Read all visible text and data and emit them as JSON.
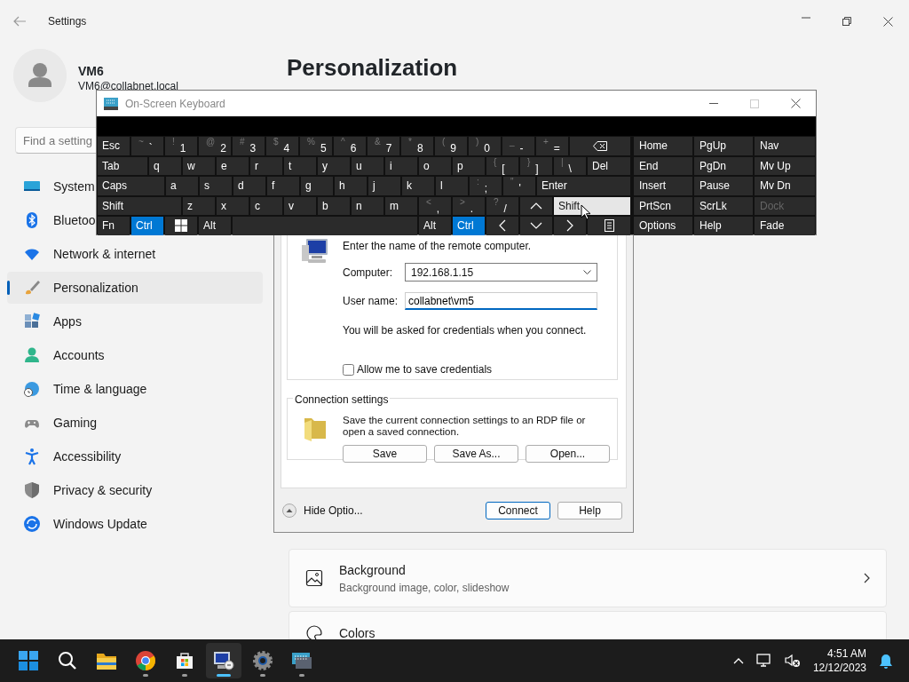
{
  "settings": {
    "title": "Settings",
    "account": {
      "name": "VM6",
      "email": "VM6@collabnet.local"
    },
    "search": {
      "placeholder": "Find a setting"
    },
    "nav": [
      {
        "kind": "system",
        "label": "System",
        "selected": false
      },
      {
        "kind": "bluetooth",
        "label": "Bluetoo",
        "selected": false
      },
      {
        "kind": "network",
        "label": "Network & internet",
        "selected": false
      },
      {
        "kind": "personalization",
        "label": "Personalization",
        "selected": true
      },
      {
        "kind": "apps",
        "label": "Apps",
        "selected": false
      },
      {
        "kind": "accounts",
        "label": "Accounts",
        "selected": false
      },
      {
        "kind": "time",
        "label": "Time & language",
        "selected": false
      },
      {
        "kind": "gaming",
        "label": "Gaming",
        "selected": false
      },
      {
        "kind": "accessibility",
        "label": "Accessibility",
        "selected": false
      },
      {
        "kind": "privacy",
        "label": "Privacy & security",
        "selected": false
      },
      {
        "kind": "update",
        "label": "Windows Update",
        "selected": false
      }
    ],
    "page_title": "Personalization",
    "cards": [
      {
        "kind": "background",
        "title": "Background",
        "subtitle": "Background image, color, slideshow"
      },
      {
        "kind": "colors",
        "title": "Colors"
      }
    ]
  },
  "remote_desktop": {
    "prompt": "Enter the name of the remote computer.",
    "computer": {
      "label": "Computer:",
      "value": "192.168.1.15"
    },
    "user": {
      "label": "User name:",
      "value": "collabnet\\vm5",
      "focused": true
    },
    "note": "You will be asked for credentials when you connect.",
    "save_credentials": {
      "label": "Allow me to save credentials",
      "checked": false
    },
    "connection_settings": {
      "legend": "Connection settings",
      "text": "Save the current connection settings to an RDP file or open a saved connection.",
      "buttons": [
        "Save",
        "Save As...",
        "Open..."
      ]
    },
    "options_toggle": "Hide Optio...",
    "buttons": [
      {
        "label": "Connect",
        "default": true
      },
      {
        "label": "Help",
        "default": false
      }
    ]
  },
  "keyboard": {
    "title": "On-Screen Keyboard",
    "rows": [
      [
        {
          "kind": "text",
          "label": "Esc",
          "pressed": false,
          "hovered": false
        },
        {
          "kind": "text",
          "label": "`",
          "shift": "~",
          "pressed": false,
          "hovered": false
        },
        {
          "kind": "text",
          "label": "1",
          "shift": "!",
          "pressed": false,
          "hovered": false
        },
        {
          "kind": "text",
          "label": "2",
          "shift": "@",
          "pressed": false,
          "hovered": false
        },
        {
          "kind": "text",
          "label": "3",
          "shift": "#",
          "pressed": false,
          "hovered": false
        },
        {
          "kind": "text",
          "label": "4",
          "shift": "$",
          "pressed": false,
          "hovered": false
        },
        {
          "kind": "text",
          "label": "5",
          "shift": "%",
          "pressed": false,
          "hovered": false
        },
        {
          "kind": "text",
          "label": "6",
          "shift": "^",
          "pressed": false,
          "hovered": false
        },
        {
          "kind": "text",
          "label": "7",
          "shift": "&",
          "pressed": false,
          "hovered": false
        },
        {
          "kind": "text",
          "label": "8",
          "shift": "*",
          "pressed": false,
          "hovered": false
        },
        {
          "kind": "text",
          "label": "9",
          "shift": "(",
          "pressed": false,
          "hovered": false
        },
        {
          "kind": "text",
          "label": "0",
          "shift": ")",
          "pressed": false,
          "hovered": false
        },
        {
          "kind": "text",
          "label": "-",
          "shift": "_",
          "pressed": false,
          "hovered": false
        },
        {
          "kind": "text",
          "label": "=",
          "shift": "+",
          "pressed": false,
          "hovered": false
        },
        {
          "kind": "backspace",
          "pressed": false,
          "hovered": false
        }
      ],
      [
        {
          "kind": "text",
          "label": "Tab",
          "pressed": false,
          "hovered": false
        },
        {
          "kind": "text",
          "label": "q",
          "pressed": false,
          "hovered": false
        },
        {
          "kind": "text",
          "label": "w",
          "pressed": false,
          "hovered": false
        },
        {
          "kind": "text",
          "label": "e",
          "pressed": false,
          "hovered": false
        },
        {
          "kind": "text",
          "label": "r",
          "pressed": false,
          "hovered": false
        },
        {
          "kind": "text",
          "label": "t",
          "pressed": false,
          "hovered": false
        },
        {
          "kind": "text",
          "label": "y",
          "pressed": false,
          "hovered": false
        },
        {
          "kind": "text",
          "label": "u",
          "pressed": false,
          "hovered": false
        },
        {
          "kind": "text",
          "label": "i",
          "pressed": false,
          "hovered": false
        },
        {
          "kind": "text",
          "label": "o",
          "pressed": false,
          "hovered": false
        },
        {
          "kind": "text",
          "label": "p",
          "pressed": false,
          "hovered": false
        },
        {
          "kind": "text",
          "label": "[",
          "shift": "{",
          "pressed": false,
          "hovered": false
        },
        {
          "kind": "text",
          "label": "]",
          "shift": "}",
          "pressed": false,
          "hovered": false
        },
        {
          "kind": "text",
          "label": "\\",
          "shift": "|",
          "pressed": false,
          "hovered": false
        },
        {
          "kind": "text",
          "label": "Del",
          "pressed": false,
          "hovered": false
        }
      ],
      [
        {
          "kind": "text",
          "label": "Caps",
          "pressed": false,
          "hovered": false
        },
        {
          "kind": "text",
          "label": "a",
          "pressed": false,
          "hovered": false
        },
        {
          "kind": "text",
          "label": "s",
          "pressed": false,
          "hovered": false
        },
        {
          "kind": "text",
          "label": "d",
          "pressed": false,
          "hovered": false
        },
        {
          "kind": "text",
          "label": "f",
          "pressed": false,
          "hovered": false
        },
        {
          "kind": "text",
          "label": "g",
          "pressed": false,
          "hovered": false
        },
        {
          "kind": "text",
          "label": "h",
          "pressed": false,
          "hovered": false
        },
        {
          "kind": "text",
          "label": "j",
          "pressed": false,
          "hovered": false
        },
        {
          "kind": "text",
          "label": "k",
          "pressed": false,
          "hovered": false
        },
        {
          "kind": "text",
          "label": "l",
          "pressed": false,
          "hovered": false
        },
        {
          "kind": "text",
          "label": ";",
          "shift": ":",
          "pressed": false,
          "hovered": false
        },
        {
          "kind": "text",
          "label": "'",
          "shift": "\"",
          "pressed": false,
          "hovered": false
        },
        {
          "kind": "text",
          "label": "Enter",
          "pressed": false,
          "hovered": false
        }
      ],
      [
        {
          "kind": "text",
          "label": "Shift",
          "pressed": false,
          "hovered": false
        },
        {
          "kind": "text",
          "label": "z",
          "pressed": false,
          "hovered": false
        },
        {
          "kind": "text",
          "label": "x",
          "pressed": false,
          "hovered": false
        },
        {
          "kind": "text",
          "label": "c",
          "pressed": false,
          "hovered": false
        },
        {
          "kind": "text",
          "label": "v",
          "pressed": false,
          "hovered": false
        },
        {
          "kind": "text",
          "label": "b",
          "pressed": false,
          "hovered": false
        },
        {
          "kind": "text",
          "label": "n",
          "pressed": false,
          "hovered": false
        },
        {
          "kind": "text",
          "label": "m",
          "pressed": false,
          "hovered": false
        },
        {
          "kind": "text",
          "label": ",",
          "shift": "<",
          "pressed": false,
          "hovered": false
        },
        {
          "kind": "text",
          "label": ".",
          "shift": ">",
          "pressed": false,
          "hovered": false
        },
        {
          "kind": "text",
          "label": "/",
          "shift": "?",
          "pressed": false,
          "hovered": false
        },
        {
          "kind": "up",
          "pressed": false,
          "hovered": false
        },
        {
          "kind": "text",
          "label": "Shift",
          "pressed": false,
          "hovered": true
        }
      ],
      [
        {
          "kind": "text",
          "label": "Fn",
          "pressed": false,
          "hovered": false
        },
        {
          "kind": "text",
          "label": "Ctrl",
          "pressed": true,
          "hovered": false
        },
        {
          "kind": "windows",
          "pressed": false,
          "hovered": false
        },
        {
          "kind": "text",
          "label": "Alt",
          "pressed": false,
          "hovered": false
        },
        {
          "kind": "space",
          "pressed": false,
          "hovered": false
        },
        {
          "kind": "text",
          "label": "Alt",
          "pressed": false,
          "hovered": false
        },
        {
          "kind": "text",
          "label": "Ctrl",
          "pressed": true,
          "hovered": false
        },
        {
          "kind": "left",
          "pressed": false,
          "hovered": false
        },
        {
          "kind": "down",
          "pressed": false,
          "hovered": false
        },
        {
          "kind": "right",
          "pressed": false,
          "hovered": false
        },
        {
          "kind": "menu",
          "pressed": false,
          "hovered": false
        }
      ]
    ],
    "nav_rows": [
      [
        {
          "label": "Home",
          "disabled": false
        },
        {
          "label": "PgUp",
          "disabled": false
        },
        {
          "label": "Nav",
          "disabled": false
        }
      ],
      [
        {
          "label": "End",
          "disabled": false
        },
        {
          "label": "PgDn",
          "disabled": false
        },
        {
          "label": "Mv Up",
          "disabled": false
        }
      ],
      [
        {
          "label": "Insert",
          "disabled": false
        },
        {
          "label": "Pause",
          "disabled": false
        },
        {
          "label": "Mv Dn",
          "disabled": false
        }
      ],
      [
        {
          "label": "PrtScn",
          "disabled": false
        },
        {
          "label": "ScrLk",
          "disabled": false
        },
        {
          "label": "Dock",
          "disabled": true
        }
      ],
      [
        {
          "label": "Options",
          "disabled": false
        },
        {
          "label": "Help",
          "disabled": false
        },
        {
          "label": "Fade",
          "disabled": false
        }
      ]
    ]
  },
  "taskbar": {
    "apps": [
      {
        "kind": "start",
        "running": false,
        "selected": false
      },
      {
        "kind": "search",
        "running": false,
        "selected": false
      },
      {
        "kind": "folder",
        "running": false,
        "selected": false
      },
      {
        "kind": "browser",
        "running": true,
        "selected": false
      },
      {
        "kind": "store",
        "running": true,
        "selected": false
      },
      {
        "kind": "remote",
        "running": true,
        "selected": true
      },
      {
        "kind": "settings",
        "running": true,
        "selected": false
      },
      {
        "kind": "keyboard",
        "running": true,
        "selected": false
      }
    ],
    "time": "4:51 AM",
    "date": "12/12/2023"
  }
}
